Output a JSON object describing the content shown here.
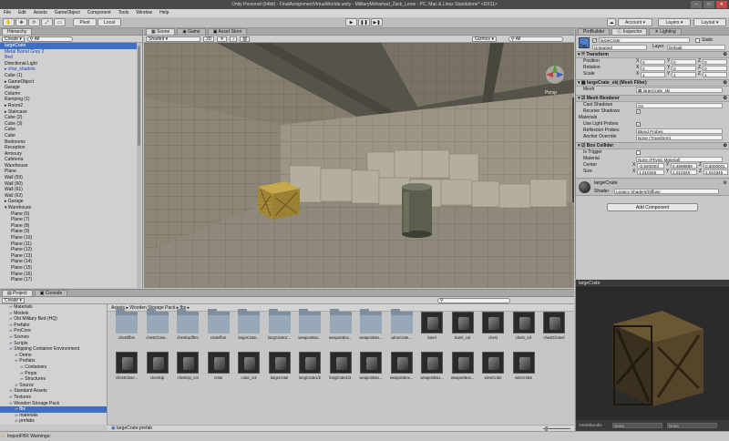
{
  "window": {
    "title": "Unity Personal (64bit) - FinalAssignmentVirtualWorlds.unity - MilitaryMohamad_Zack_Leow - PC, Mac & Linux Standalone* <DX11>"
  },
  "menu": [
    "File",
    "Edit",
    "Assets",
    "GameObject",
    "Component",
    "Tools",
    "Window",
    "Help"
  ],
  "toolbar": {
    "pivot": "Pivot",
    "local": "Local",
    "account": "Account",
    "layers": "Layers",
    "layout": "Layout"
  },
  "hierarchy": {
    "tab": "Hierarchy",
    "create": "Create",
    "search": "All",
    "items": [
      {
        "t": "largeCrate",
        "i": 0,
        "c": "#1d3fbf"
      },
      {
        "t": "Metal Barrel Grey 2",
        "i": 0,
        "c": "#1d3fbf"
      },
      {
        "t": "Bed",
        "i": 0,
        "c": "#1d3fbf"
      },
      {
        "t": "Directional Light",
        "i": 0,
        "c": "#111"
      },
      {
        "t": "▸ char_shadow",
        "i": 0,
        "c": "#1d3fbf"
      },
      {
        "t": "Cube (1)",
        "i": 0,
        "c": "#111"
      },
      {
        "t": "▸ GameObject",
        "i": 0,
        "c": "#111"
      },
      {
        "t": "Garage",
        "i": 0,
        "c": "#111"
      },
      {
        "t": "Column",
        "i": 0,
        "c": "#111"
      },
      {
        "t": "Ramping (1)",
        "i": 0,
        "c": "#111"
      },
      {
        "t": "▸ Room2",
        "i": 0,
        "c": "#111"
      },
      {
        "t": "▸ Staircase",
        "i": 0,
        "c": "#111"
      },
      {
        "t": "Cube (2)",
        "i": 0,
        "c": "#111"
      },
      {
        "t": "Cube (3)",
        "i": 0,
        "c": "#111"
      },
      {
        "t": "Cube",
        "i": 0,
        "c": "#111"
      },
      {
        "t": "Cube",
        "i": 0,
        "c": "#111"
      },
      {
        "t": "Bedrooms",
        "i": 0,
        "c": "#111"
      },
      {
        "t": "Reception",
        "i": 0,
        "c": "#111"
      },
      {
        "t": "Armoury",
        "i": 0,
        "c": "#111"
      },
      {
        "t": "Cafeteria",
        "i": 0,
        "c": "#111"
      },
      {
        "t": "Warehouse",
        "i": 0,
        "c": "#111"
      },
      {
        "t": "Plane",
        "i": 0,
        "c": "#111"
      },
      {
        "t": "Wall (59)",
        "i": 0,
        "c": "#111"
      },
      {
        "t": "Wall (60)",
        "i": 0,
        "c": "#111"
      },
      {
        "t": "Wall (61)",
        "i": 0,
        "c": "#111"
      },
      {
        "t": "Wall (62)",
        "i": 0,
        "c": "#111"
      },
      {
        "t": "▸ Garage",
        "i": 0,
        "c": "#111"
      },
      {
        "t": "▾ Warehouse",
        "i": 0,
        "c": "#111"
      },
      {
        "t": "Plane (6)",
        "i": 1,
        "c": "#111"
      },
      {
        "t": "Plane (7)",
        "i": 1,
        "c": "#111"
      },
      {
        "t": "Plane (8)",
        "i": 1,
        "c": "#111"
      },
      {
        "t": "Plane (9)",
        "i": 1,
        "c": "#111"
      },
      {
        "t": "Plane (10)",
        "i": 1,
        "c": "#111"
      },
      {
        "t": "Plane (11)",
        "i": 1,
        "c": "#111"
      },
      {
        "t": "Plane (12)",
        "i": 1,
        "c": "#111"
      },
      {
        "t": "Plane (13)",
        "i": 1,
        "c": "#111"
      },
      {
        "t": "Plane (14)",
        "i": 1,
        "c": "#111"
      },
      {
        "t": "Plane (15)",
        "i": 1,
        "c": "#111"
      },
      {
        "t": "Plane (16)",
        "i": 1,
        "c": "#111"
      },
      {
        "t": "Plane (17)",
        "i": 1,
        "c": "#111"
      }
    ]
  },
  "scene": {
    "tabs": [
      "Scene",
      "Game",
      "Asset Store"
    ],
    "shading": "Shaded",
    "mode": "2D",
    "gizmos": "Gizmos",
    "all": "All",
    "persp": "Persp"
  },
  "inspector": {
    "tabs": [
      "ProBuilder",
      "Inspector",
      "Lighting"
    ],
    "name": "largeCrate",
    "static": "Static",
    "tag_label": "Tag",
    "tag": "Untagged",
    "layer_label": "Layer",
    "layer": "Default",
    "transform": {
      "title": "Transform",
      "position": "Position",
      "rotation": "Rotation",
      "scale": "Scale",
      "pos": [
        "0",
        "0",
        "0"
      ],
      "rot": [
        "0",
        "0",
        "0"
      ],
      "scl": [
        "1",
        "1",
        "1"
      ]
    },
    "meshfilter": {
      "title": "largeCrate_skj (Mesh Filter)",
      "mesh_label": "Mesh",
      "mesh": "largeCrate_skj"
    },
    "renderer": {
      "title": "Mesh Renderer",
      "cast_label": "Cast Shadows",
      "cast": "On",
      "receive_label": "Receive Shadows",
      "materials": "Materials",
      "probes_label": "Use Light Probes",
      "refl_label": "Reflection Probes",
      "refl": "Blend Probes",
      "anchor_label": "Anchor Override",
      "anchor": "None (Transform)"
    },
    "collider": {
      "title": "Box Collider",
      "trigger_label": "Is Trigger",
      "material_label": "Material",
      "material": "None (Physic Material)",
      "center_label": "Center",
      "center": [
        "-0.500000(",
        "0.4999999",
        "0.5000001"
      ],
      "size_label": "Size",
      "size": [
        "1.010345",
        "1.010345",
        "1.010345"
      ]
    },
    "mat": {
      "name": "largeCrate",
      "shader_label": "Shader",
      "shader": "Legacy Shaders/Diffuse"
    },
    "add": "Add Component"
  },
  "project": {
    "tabs": [
      "Project",
      "Console"
    ],
    "create": "Create",
    "breadcrumb": "Assets ▸ Wooden Storage Pack ▸ fbx ▸",
    "tree": [
      {
        "t": "Materials",
        "i": 1
      },
      {
        "t": "Models",
        "i": 1
      },
      {
        "t": "Old Military Bed (HQ)",
        "i": 1
      },
      {
        "t": "Prefabs",
        "i": 1
      },
      {
        "t": "ProCore",
        "i": 1
      },
      {
        "t": "Scenes",
        "i": 1
      },
      {
        "t": "Scripts",
        "i": 1
      },
      {
        "t": "Shipping Container Environment",
        "i": 1
      },
      {
        "t": "Demo",
        "i": 2
      },
      {
        "t": "Prefabs",
        "i": 2
      },
      {
        "t": "Containers",
        "i": 3
      },
      {
        "t": "Props",
        "i": 3
      },
      {
        "t": "Structures",
        "i": 3
      },
      {
        "t": "Source",
        "i": 2
      },
      {
        "t": "Standard Assets",
        "i": 1
      },
      {
        "t": "Textures",
        "i": 1
      },
      {
        "t": "Wooden Storage Pack",
        "i": 1
      },
      {
        "t": "fbx",
        "i": 2
      },
      {
        "t": "materials",
        "i": 2
      },
      {
        "t": "prefabs",
        "i": 2
      },
      {
        "t": "texture",
        "i": 2
      }
    ],
    "row1": [
      {
        "n": "chest/fbm",
        "k": "folder"
      },
      {
        "n": "chestClose...",
        "k": "folder"
      },
      {
        "n": "chestUp/fbm",
        "k": "folder"
      },
      {
        "n": "crate/fbm",
        "k": "folder"
      },
      {
        "n": "largeCrate...",
        "k": "folder"
      },
      {
        "n": "longCrate1/...",
        "k": "folder"
      },
      {
        "n": "weaponBox...",
        "k": "folder"
      },
      {
        "n": "weaponBox...",
        "k": "folder"
      },
      {
        "n": "weaponBox...",
        "k": "folder"
      },
      {
        "n": "wineCrate...",
        "k": "folder"
      },
      {
        "n": "barel",
        "k": "mesh"
      },
      {
        "n": "barel_col",
        "k": "mesh"
      },
      {
        "n": "chest",
        "k": "mesh"
      },
      {
        "n": "chest_col",
        "k": "mesh"
      },
      {
        "n": "chestClosed",
        "k": "mesh"
      }
    ],
    "row2": [
      {
        "n": "chestClose...",
        "k": "mesh"
      },
      {
        "n": "chestUp",
        "k": "mesh"
      },
      {
        "n": "chestUp_col",
        "k": "mesh"
      },
      {
        "n": "crate",
        "k": "mesh"
      },
      {
        "n": "crate_col",
        "k": "mesh"
      },
      {
        "n": "largeCrate",
        "k": "mesh"
      },
      {
        "n": "longCrate1/2",
        "k": "mesh"
      },
      {
        "n": "longCrate1/2",
        "k": "mesh"
      },
      {
        "n": "weaponBox...",
        "k": "mesh"
      },
      {
        "n": "weaponBox...",
        "k": "mesh"
      },
      {
        "n": "weaponBox...",
        "k": "mesh"
      },
      {
        "n": "weaponBox...",
        "k": "mesh"
      },
      {
        "n": "wineCrate",
        "k": "mesh"
      },
      {
        "n": "wineCrate",
        "k": "mesh"
      }
    ],
    "selected_file": "largeCrate.prefab"
  },
  "preview": {
    "title": "largeCrate",
    "assetbundle_label": "AssetBundle",
    "ab": "None",
    "ab2": "None"
  },
  "status": "ImportFBX Warnings:"
}
